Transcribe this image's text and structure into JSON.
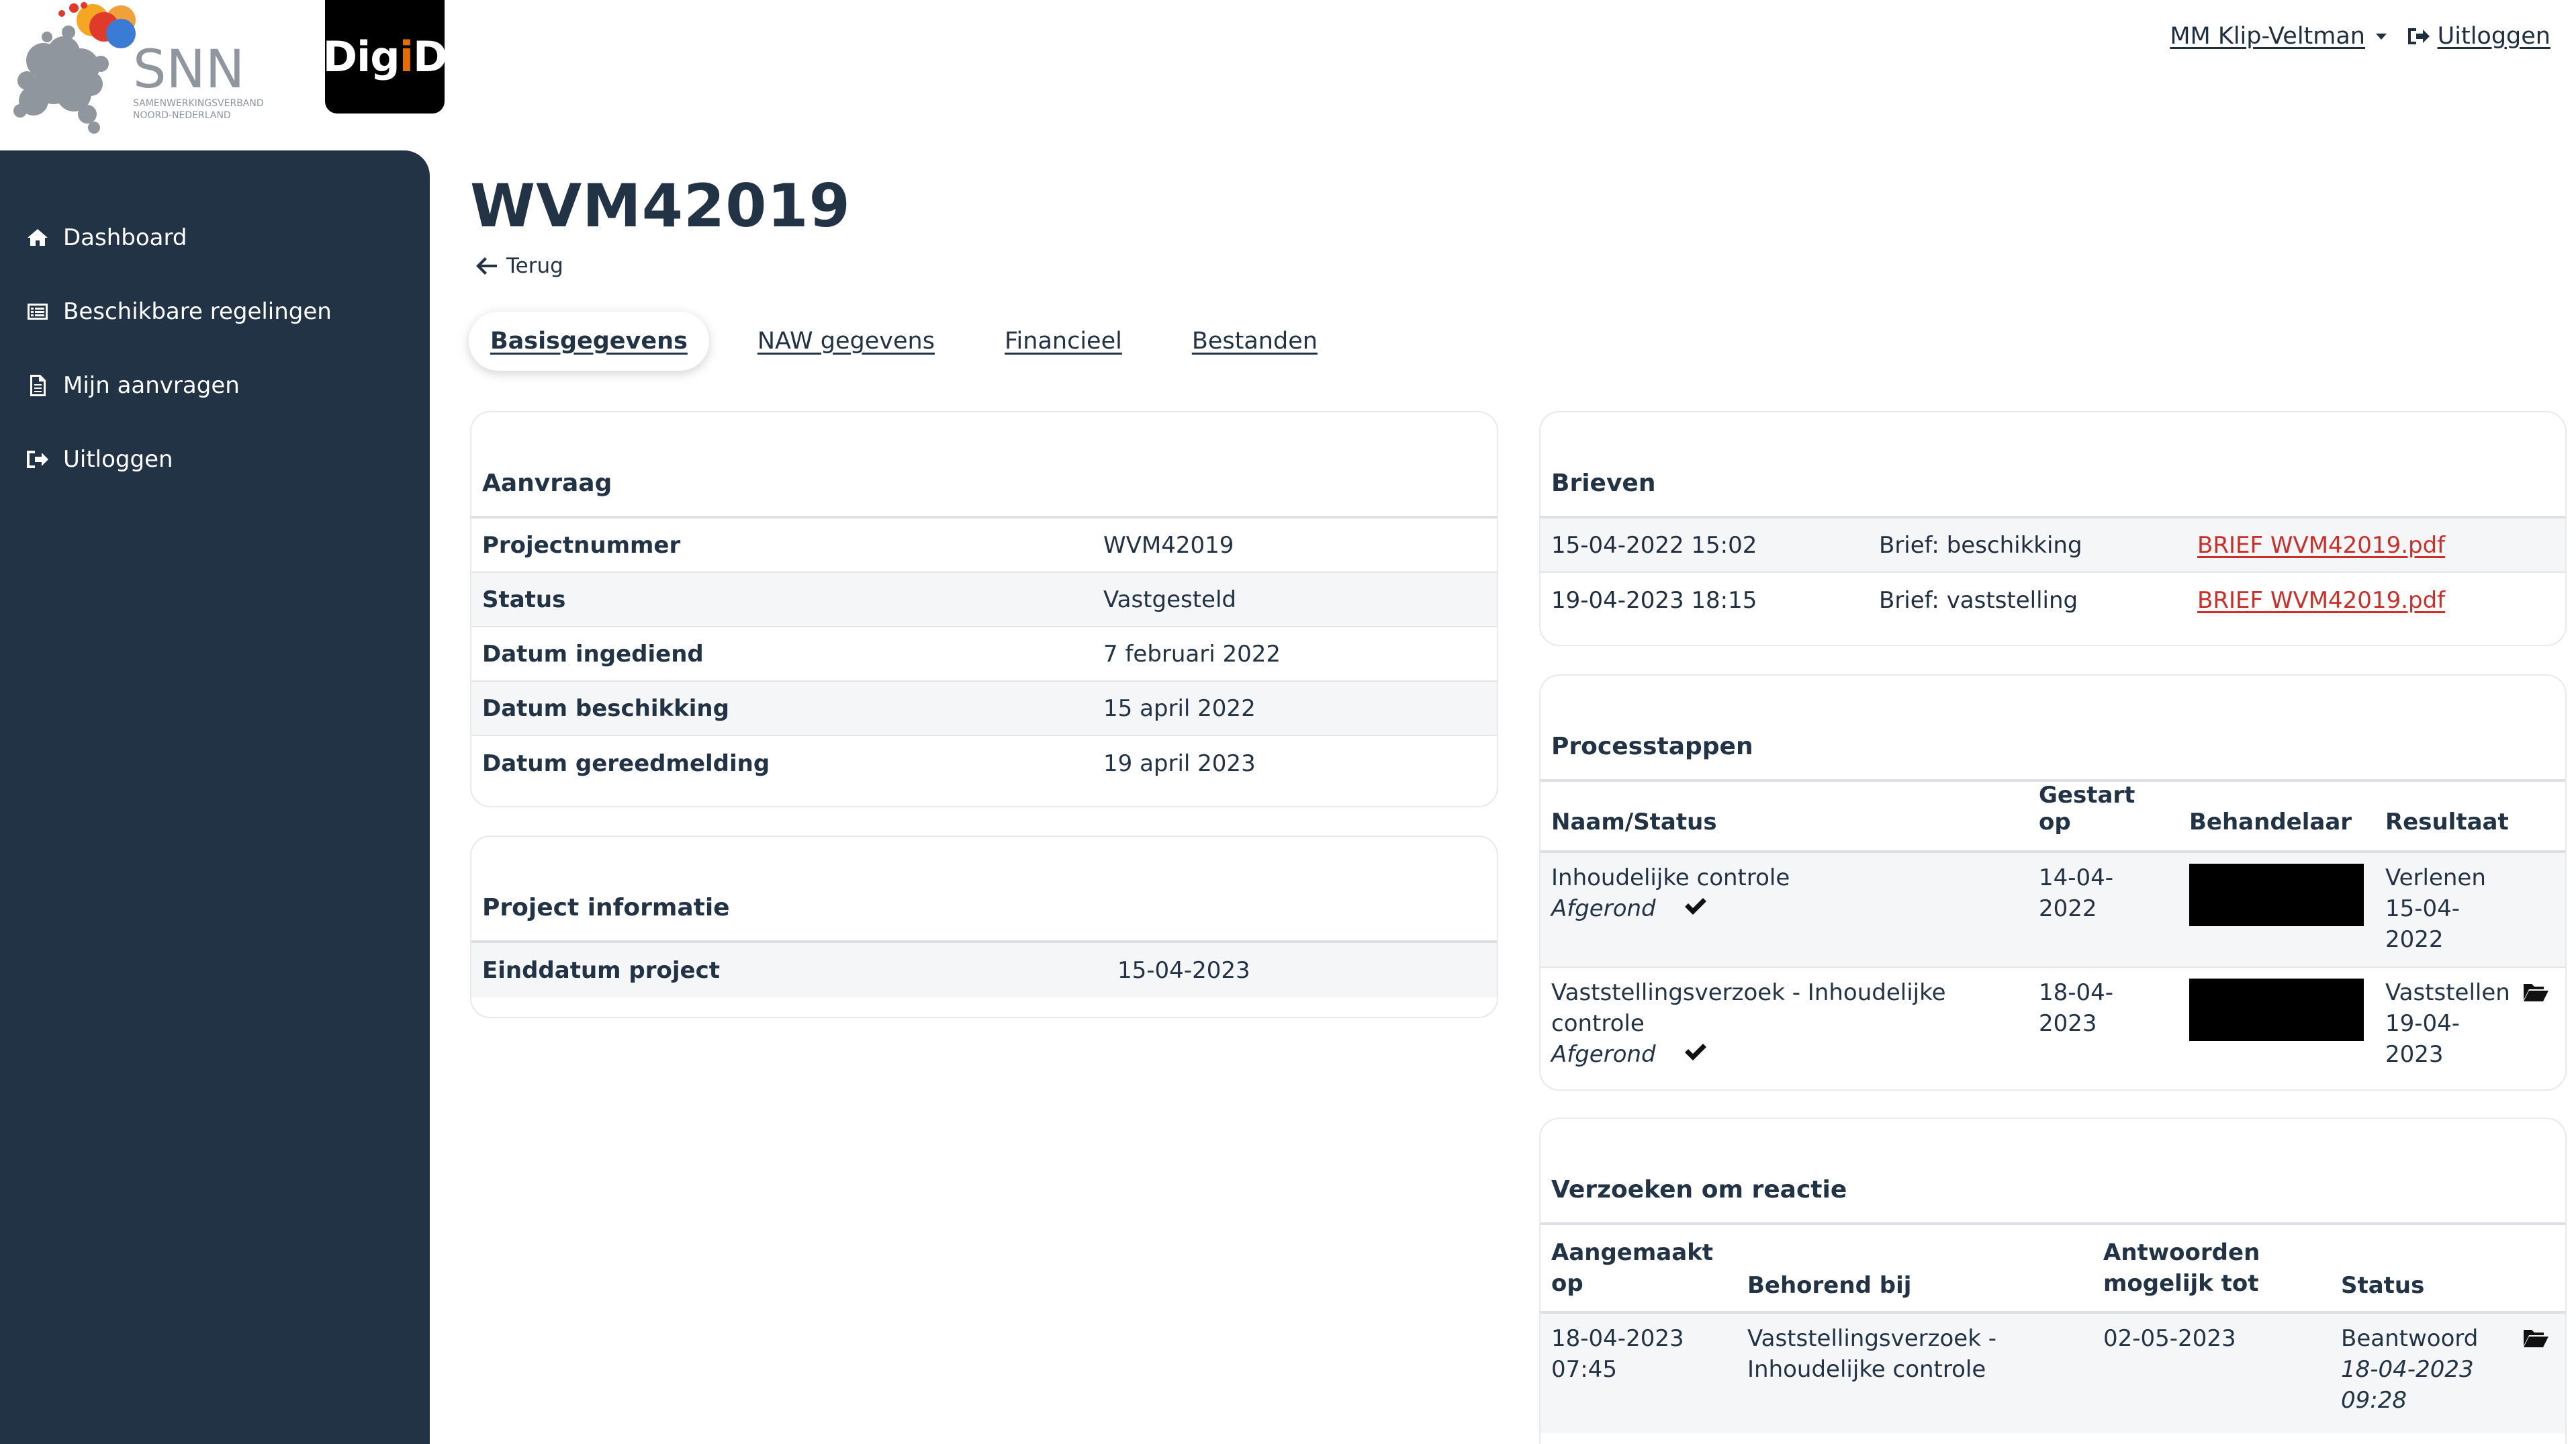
{
  "logos": {
    "snn_text": "SNN",
    "snn_subtitle_line1": "SAMENWERKINGSVERBAND",
    "snn_subtitle_line2": "NOORD-NEDERLAND",
    "digid_text": "DigiD"
  },
  "header": {
    "user_name": "MM Klip-Veltman",
    "logout_label": "Uitloggen"
  },
  "sidebar": {
    "items": [
      {
        "label": "Dashboard",
        "icon": "home-icon"
      },
      {
        "label": "Beschikbare regelingen",
        "icon": "list-icon"
      },
      {
        "label": "Mijn aanvragen",
        "icon": "document-icon"
      },
      {
        "label": "Uitloggen",
        "icon": "sign-out-icon"
      }
    ]
  },
  "page": {
    "title": "WVM42019",
    "back_label": "Terug"
  },
  "tabs": [
    {
      "label": "Basisgegevens",
      "active": true
    },
    {
      "label": "NAW gegevens",
      "active": false
    },
    {
      "label": "Financieel",
      "active": false
    },
    {
      "label": "Bestanden",
      "active": false
    }
  ],
  "aanvraag": {
    "title": "Aanvraag",
    "rows": [
      {
        "key": "Projectnummer",
        "value": "WVM42019"
      },
      {
        "key": "Status",
        "value": "Vastgesteld"
      },
      {
        "key": "Datum ingediend",
        "value": "7 februari 2022"
      },
      {
        "key": "Datum beschikking",
        "value": "15 april 2022"
      },
      {
        "key": "Datum gereedmelding",
        "value": "19 april 2023"
      }
    ]
  },
  "project_informatie": {
    "title": "Project informatie",
    "rows": [
      {
        "key": "Einddatum project",
        "value": "15-04-2023"
      }
    ]
  },
  "brieven": {
    "title": "Brieven",
    "rows": [
      {
        "date": "15-04-2022 15:02",
        "type": "Brief: beschikking",
        "file": "BRIEF WVM42019.pdf"
      },
      {
        "date": "19-04-2023 18:15",
        "type": "Brief: vaststelling",
        "file": "BRIEF WVM42019.pdf"
      }
    ]
  },
  "processtappen": {
    "title": "Processtappen",
    "headers": [
      "Naam/Status",
      "Gestart op",
      "Behandelaar",
      "Resultaat"
    ],
    "rows": [
      {
        "name": "Inhoudelijke controle",
        "status": "Afgerond",
        "started_l1": "14-04-",
        "started_l2": "2022",
        "result_l1": "Verlenen",
        "result_l2": "15-04-",
        "result_l3": "2022"
      },
      {
        "name_l1": "Vaststellingsverzoek - Inhoudelijke",
        "name_l2": "controle",
        "status": "Afgerond",
        "started_l1": "18-04-",
        "started_l2": "2023",
        "result_l1": "Vaststellen",
        "result_l2": "19-04-",
        "result_l3": "2023"
      }
    ]
  },
  "verzoeken": {
    "title": "Verzoeken om reactie",
    "headers": {
      "aangemaakt_l1": "Aangemaakt",
      "aangemaakt_l2": "op",
      "behorend": "Behorend bij",
      "antwoorden_l1": "Antwoorden",
      "antwoorden_l2": "mogelijk tot",
      "status": "Status"
    },
    "rows": [
      {
        "created_l1": "18-04-2023",
        "created_l2": "07:45",
        "related_l1": "Vaststellingsverzoek -",
        "related_l2": "Inhoudelijke controle",
        "deadline": "02-05-2023",
        "status": "Beantwoord",
        "status_date_l1": "18-04-2023",
        "status_date_l2": "09:28"
      }
    ]
  },
  "colors": {
    "sidebar_bg": "#213345",
    "link_red": "#cc2f2a",
    "digid_bg": "#000000",
    "digid_accent": "#e17000"
  }
}
